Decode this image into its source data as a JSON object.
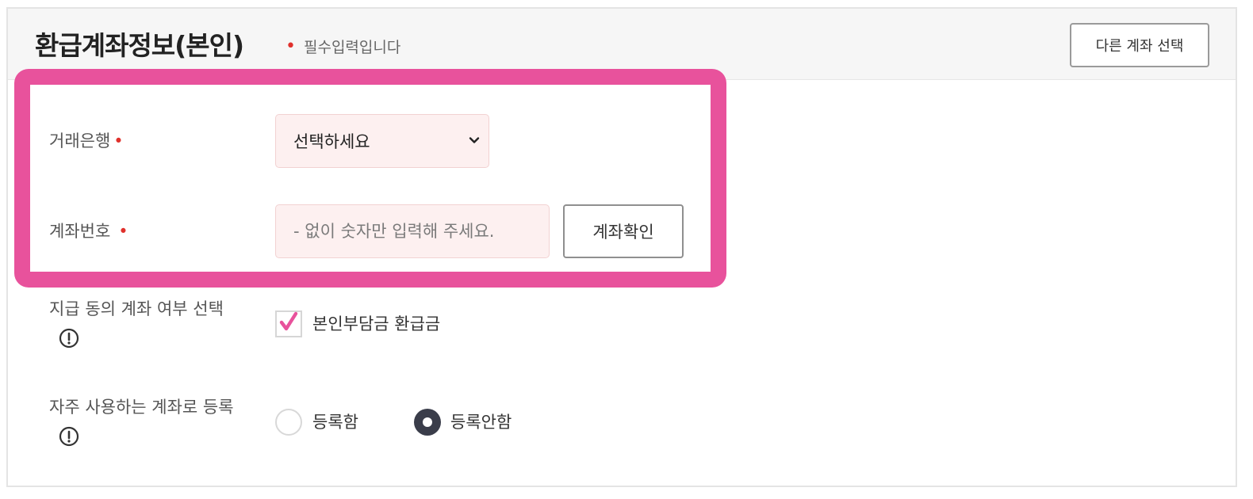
{
  "header": {
    "title": "환급계좌정보(본인)",
    "required_mark": "•",
    "required_note": "필수입력입니다",
    "other_account_button": "다른 계좌 선택"
  },
  "bank": {
    "label": "거래은행",
    "required_mark": "•",
    "select_value": "선택하세요",
    "chevron_icon": "chevron-down-icon"
  },
  "account": {
    "label": "계좌번호",
    "required_mark": "•",
    "placeholder": "- 없이 숫자만 입력해 주세요.",
    "value": "",
    "confirm_button": "계좌확인"
  },
  "payment_consent": {
    "label": "지급 동의 계좌 여부 선택",
    "info_icon": "info-icon",
    "checkbox_label": "본인부담금 환급금",
    "checked": true
  },
  "frequent": {
    "label": "자주 사용하는 계좌로 등록",
    "info_icon": "info-icon",
    "options": [
      "등록함",
      "등록안함"
    ],
    "selected": "등록안함"
  },
  "colors": {
    "highlight": "#e8529c",
    "required": "#e0312c",
    "input_bg": "#fdf0f0",
    "radio_selected": "#3a3d4a"
  }
}
